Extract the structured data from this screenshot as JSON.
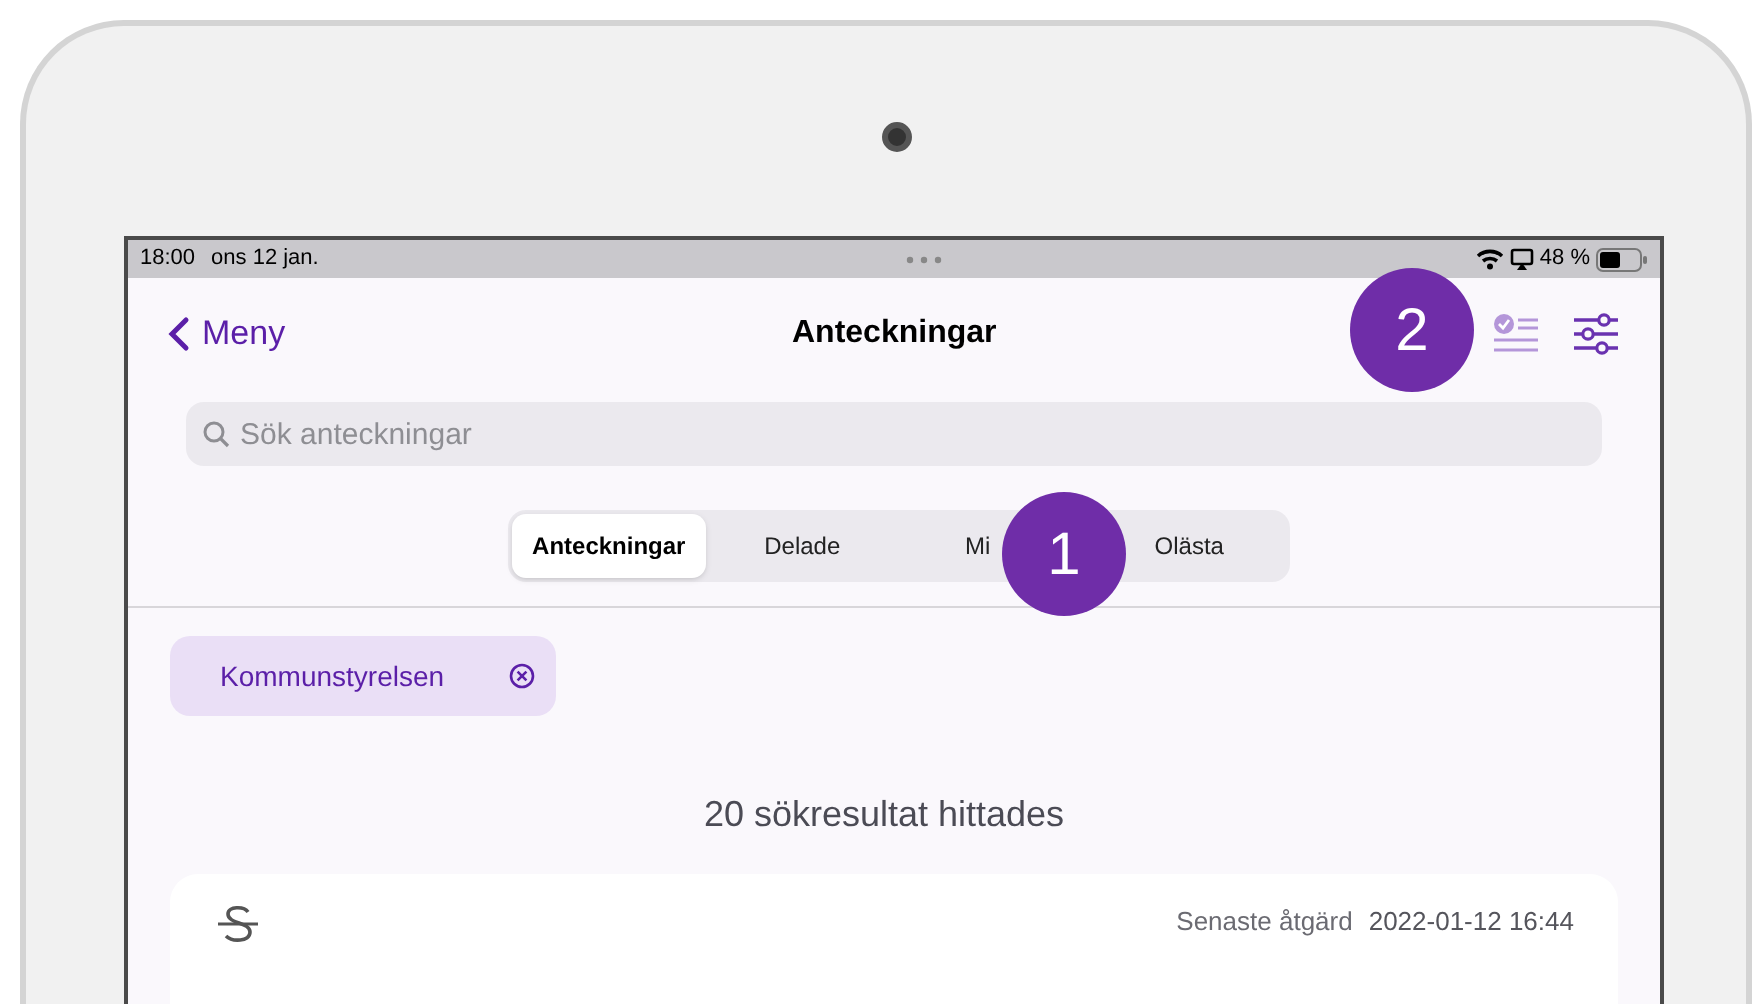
{
  "status_bar": {
    "time": "18:00",
    "date": "ons 12 jan.",
    "battery": "48 %"
  },
  "nav": {
    "back": "Meny",
    "title": "Anteckningar"
  },
  "search": {
    "placeholder": "Sök anteckningar"
  },
  "segments": [
    {
      "label": "Anteckningar",
      "selected": true
    },
    {
      "label": "Delade",
      "selected": false
    },
    {
      "label": "Mi",
      "selected": false
    },
    {
      "label": "Olästa",
      "selected": false
    }
  ],
  "filter_chips": [
    {
      "label": "Kommunstyrelsen"
    }
  ],
  "result_count": "20 sökresultat hittades",
  "notes": [
    {
      "last_action_label": "Senaste åtgärd",
      "last_action_time": "2022-01-12 16:44"
    }
  ],
  "callouts": [
    {
      "number": "1"
    },
    {
      "number": "2"
    }
  ]
}
